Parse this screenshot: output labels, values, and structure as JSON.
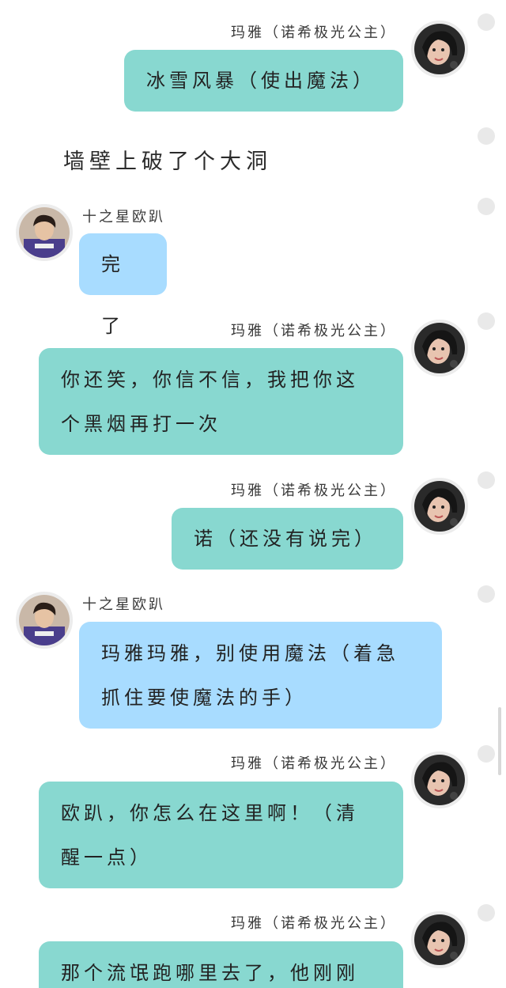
{
  "colors": {
    "right_bubble": "#88d8d0",
    "left_bubble": "#a8dcff",
    "background": "#ffffff"
  },
  "messages": [
    {
      "side": "right",
      "sender": "玛雅（诺希极光公主）",
      "avatar": "girl-avatar",
      "text": "冰雪风暴（使出魔法）"
    },
    {
      "side": "narration",
      "text": "墙壁上破了个大洞"
    },
    {
      "side": "left",
      "sender": "十之星欧趴",
      "avatar": "boy-avatar",
      "text": "完了"
    },
    {
      "side": "right",
      "sender": "玛雅（诺希极光公主）",
      "avatar": "girl-avatar",
      "lines": [
        "你还笑，你信不信，我把你这",
        "个黑烟再打一次"
      ]
    },
    {
      "side": "right",
      "sender": "玛雅（诺希极光公主）",
      "avatar": "girl-avatar",
      "text": "诺（还没有说完）"
    },
    {
      "side": "left",
      "sender": "十之星欧趴",
      "avatar": "boy-avatar",
      "lines": [
        "玛雅玛雅，别使用魔法（着急",
        "抓住要使魔法的手）"
      ]
    },
    {
      "side": "right",
      "sender": "玛雅（诺希极光公主）",
      "avatar": "girl-avatar",
      "lines": [
        "欧趴，你怎么在这里啊！（清",
        "醒一点）"
      ]
    },
    {
      "side": "right",
      "sender": "玛雅（诺希极光公主）",
      "avatar": "girl-avatar",
      "lines": [
        "那个流氓跑哪里去了，他刚刚"
      ]
    }
  ]
}
